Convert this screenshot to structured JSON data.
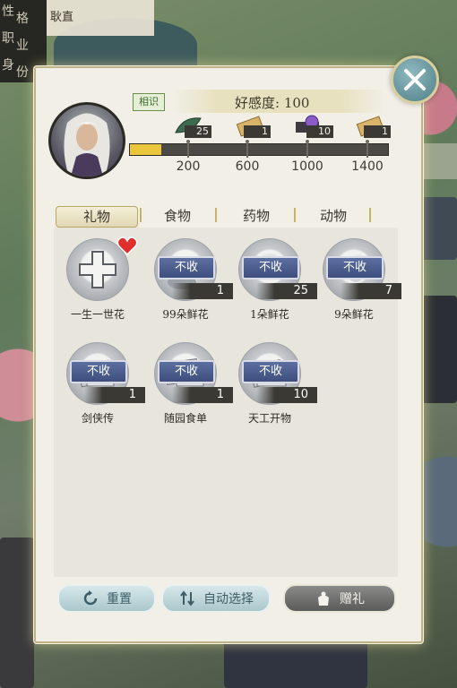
{
  "character_info": {
    "row_labels": [
      "性",
      "格",
      "职",
      "业",
      "身",
      "份"
    ],
    "trait_value": "耿直"
  },
  "relationship": {
    "badge": "相识",
    "favor_text": "好感度: 100",
    "favor_value": 100,
    "progress_fraction": 0.12,
    "milestones": [
      {
        "threshold": "200",
        "reward_icon": "green-leaf-icon",
        "count": "25"
      },
      {
        "threshold": "600",
        "reward_icon": "scroll-icon",
        "count": "1"
      },
      {
        "threshold": "1000",
        "reward_icon": "purple-gem-icon",
        "count": "10"
      },
      {
        "threshold": "1400",
        "reward_icon": "scroll-icon",
        "count": "1"
      }
    ]
  },
  "tabs": [
    {
      "label": "礼物",
      "active": true
    },
    {
      "label": "食物",
      "active": false
    },
    {
      "label": "药物",
      "active": false
    },
    {
      "label": "动物",
      "active": false
    }
  ],
  "items": [
    {
      "name": "一生一世花",
      "icon": "plus-icon",
      "status": "",
      "qty": "",
      "favorite": true
    },
    {
      "name": "99朵鲜花",
      "icon": "flower-icon",
      "status": "不收",
      "qty": "1",
      "favorite": false
    },
    {
      "name": "1朵鲜花",
      "icon": "flower-icon",
      "status": "不收",
      "qty": "25",
      "favorite": false
    },
    {
      "name": "9朵鲜花",
      "icon": "flower-icon",
      "status": "不收",
      "qty": "7",
      "favorite": false
    },
    {
      "name": "剑侠传",
      "icon": "book-icon",
      "status": "不收",
      "qty": "1",
      "favorite": false
    },
    {
      "name": "随园食单",
      "icon": "book-icon",
      "status": "不收",
      "qty": "1",
      "favorite": false
    },
    {
      "name": "天工开物",
      "icon": "book-icon",
      "status": "不收",
      "qty": "10",
      "favorite": false
    }
  ],
  "buttons": {
    "reset": "重置",
    "auto_select": "自动选择",
    "give_gift": "赠礼"
  },
  "colors": {
    "progress_fill": "#e9c63a",
    "no_accept_badge": "#4a5b8b",
    "panel_bg": "#f1efe6"
  }
}
